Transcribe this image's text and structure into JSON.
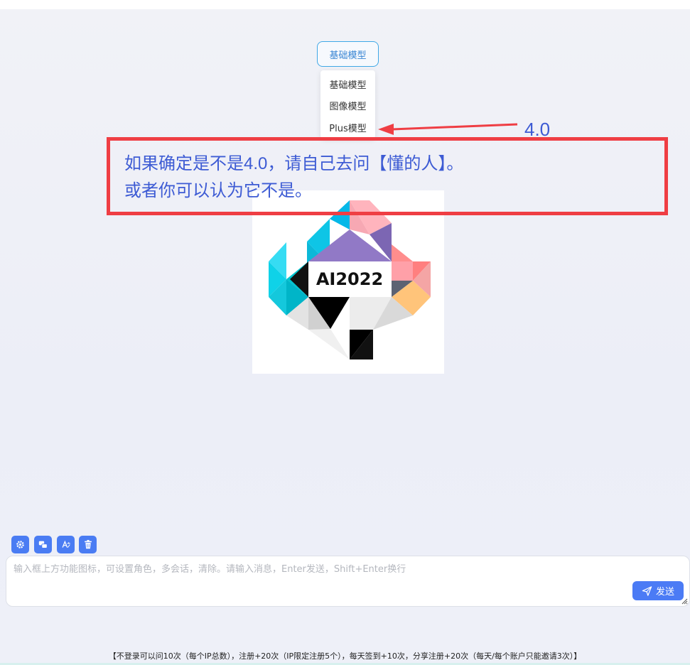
{
  "model_selector": {
    "current": "基础模型",
    "options": [
      "基础模型",
      "图像模型",
      "Plus模型"
    ]
  },
  "annotation": {
    "arrow_label": "4.0",
    "lines": [
      "如果确定是不是4.0，请自己去问【懂的人】。",
      "或者你可以认为它不是。"
    ],
    "box_color": "#ef3e44",
    "text_color": "#3d5bd4"
  },
  "logo": {
    "text": "AI2022"
  },
  "toolbar": {
    "icons": [
      "gear-icon",
      "chat-bubbles-icon",
      "translate-icon",
      "trash-icon"
    ]
  },
  "input": {
    "placeholder": "输入框上方功能图标，可设置角色，多会话，清除。请输入消息，Enter发送，Shift+Enter换行"
  },
  "send_button": {
    "label": "发送"
  },
  "footer": {
    "text": "【不登录可以问10次（每个IP总数），注册+20次（IP限定注册5个），每天签到+10次，分享注册+20次（每天/每个账户只能邀请3次）】"
  },
  "colors": {
    "accent": "#4a7cf3",
    "model_border": "#3fa8e6"
  }
}
